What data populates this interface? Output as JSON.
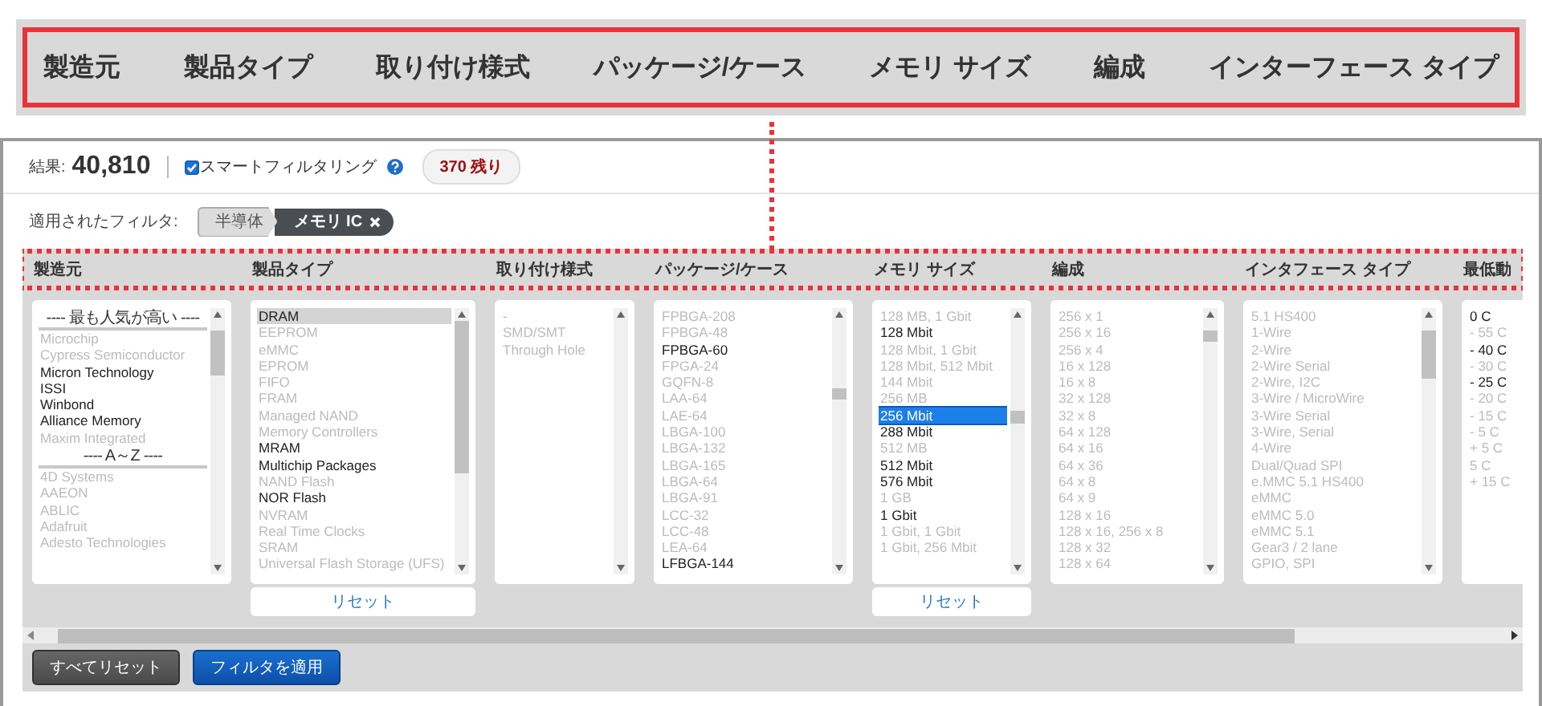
{
  "banner": {
    "headings": [
      "製造元",
      "製品タイプ",
      "取り付け様式",
      "パッケージ/ケース",
      "メモリ サイズ",
      "編成",
      "インターフェース タイプ"
    ]
  },
  "summary": {
    "results_label": "結果:",
    "results_count": "40,810",
    "smart_filtering": {
      "label": "スマートフィルタリング",
      "checked": true
    },
    "remaining": "370 残り"
  },
  "applied_filters": {
    "label": "適用されたフィルタ:",
    "chips": [
      {
        "label": "半導体",
        "kind": "category"
      },
      {
        "label": "メモリ IC",
        "kind": "removable"
      }
    ]
  },
  "columns": [
    {
      "heading": "製造元",
      "options": [
        {
          "kind": "heading",
          "label": "---- 最も人気が高い ----"
        },
        {
          "kind": "option",
          "label": "Microchip",
          "disabled": true,
          "selected": false
        },
        {
          "kind": "option",
          "label": "Cypress Semiconductor",
          "disabled": true,
          "selected": false
        },
        {
          "kind": "option",
          "label": "Micron Technology",
          "disabled": false,
          "selected": false
        },
        {
          "kind": "option",
          "label": "ISSI",
          "disabled": false,
          "selected": false
        },
        {
          "kind": "option",
          "label": "Winbond",
          "disabled": false,
          "selected": false
        },
        {
          "kind": "option",
          "label": "Alliance Memory",
          "disabled": false,
          "selected": false
        },
        {
          "kind": "option",
          "label": "Maxim Integrated",
          "disabled": true,
          "selected": false
        },
        {
          "kind": "heading",
          "label": "---- A～Z ----"
        },
        {
          "kind": "option",
          "label": "4D Systems",
          "disabled": true,
          "selected": false
        },
        {
          "kind": "option",
          "label": "AAEON",
          "disabled": true,
          "selected": false
        },
        {
          "kind": "option",
          "label": "ABLIC",
          "disabled": true,
          "selected": false
        },
        {
          "kind": "option",
          "label": "Adafruit",
          "disabled": true,
          "selected": false
        },
        {
          "kind": "option",
          "label": "Adesto Technologies",
          "disabled": true,
          "selected": false
        }
      ]
    },
    {
      "heading": "製品タイプ",
      "reset": "リセット",
      "options": [
        {
          "kind": "option",
          "label": "DRAM",
          "disabled": false,
          "selected": true,
          "focused": false
        },
        {
          "kind": "option",
          "label": "EEPROM",
          "disabled": true,
          "selected": false
        },
        {
          "kind": "option",
          "label": "eMMC",
          "disabled": true,
          "selected": false
        },
        {
          "kind": "option",
          "label": "EPROM",
          "disabled": true,
          "selected": false
        },
        {
          "kind": "option",
          "label": "FIFO",
          "disabled": true,
          "selected": false
        },
        {
          "kind": "option",
          "label": "FRAM",
          "disabled": true,
          "selected": false
        },
        {
          "kind": "option",
          "label": "Managed NAND",
          "disabled": true,
          "selected": false
        },
        {
          "kind": "option",
          "label": "Memory Controllers",
          "disabled": true,
          "selected": false
        },
        {
          "kind": "option",
          "label": "MRAM",
          "disabled": false,
          "selected": false
        },
        {
          "kind": "option",
          "label": "Multichip Packages",
          "disabled": false,
          "selected": false
        },
        {
          "kind": "option",
          "label": "NAND Flash",
          "disabled": true,
          "selected": false
        },
        {
          "kind": "option",
          "label": "NOR Flash",
          "disabled": false,
          "selected": false
        },
        {
          "kind": "option",
          "label": "NVRAM",
          "disabled": true,
          "selected": false
        },
        {
          "kind": "option",
          "label": "Real Time Clocks",
          "disabled": true,
          "selected": false
        },
        {
          "kind": "option",
          "label": "SRAM",
          "disabled": true,
          "selected": false
        },
        {
          "kind": "option",
          "label": "Universal Flash Storage (UFS)",
          "disabled": true,
          "selected": false
        }
      ]
    },
    {
      "heading": "取り付け様式",
      "options": [
        {
          "kind": "option",
          "label": "-",
          "disabled": true,
          "selected": false
        },
        {
          "kind": "option",
          "label": "SMD/SMT",
          "disabled": true,
          "selected": false
        },
        {
          "kind": "option",
          "label": "Through Hole",
          "disabled": true,
          "selected": false
        }
      ]
    },
    {
      "heading": "パッケージ/ケース",
      "options": [
        {
          "kind": "option",
          "label": "FPBGA-208",
          "disabled": true,
          "selected": false
        },
        {
          "kind": "option",
          "label": "FPBGA-48",
          "disabled": true,
          "selected": false
        },
        {
          "kind": "option",
          "label": "FPBGA-60",
          "disabled": false,
          "selected": false
        },
        {
          "kind": "option",
          "label": "FPGA-24",
          "disabled": true,
          "selected": false
        },
        {
          "kind": "option",
          "label": "GQFN-8",
          "disabled": true,
          "selected": false
        },
        {
          "kind": "option",
          "label": "LAA-64",
          "disabled": true,
          "selected": false
        },
        {
          "kind": "option",
          "label": "LAE-64",
          "disabled": true,
          "selected": false
        },
        {
          "kind": "option",
          "label": "LBGA-100",
          "disabled": true,
          "selected": false
        },
        {
          "kind": "option",
          "label": "LBGA-132",
          "disabled": true,
          "selected": false
        },
        {
          "kind": "option",
          "label": "LBGA-165",
          "disabled": true,
          "selected": false
        },
        {
          "kind": "option",
          "label": "LBGA-64",
          "disabled": true,
          "selected": false
        },
        {
          "kind": "option",
          "label": "LBGA-91",
          "disabled": true,
          "selected": false
        },
        {
          "kind": "option",
          "label": "LCC-32",
          "disabled": true,
          "selected": false
        },
        {
          "kind": "option",
          "label": "LCC-48",
          "disabled": true,
          "selected": false
        },
        {
          "kind": "option",
          "label": "LEA-64",
          "disabled": true,
          "selected": false
        },
        {
          "kind": "option",
          "label": "LFBGA-144",
          "disabled": false,
          "selected": false
        }
      ]
    },
    {
      "heading": "メモリ サイズ",
      "reset": "リセット",
      "options": [
        {
          "kind": "option",
          "label": "128 MB, 1 Gbit",
          "disabled": true,
          "selected": false
        },
        {
          "kind": "option",
          "label": "128 Mbit",
          "disabled": false,
          "selected": false
        },
        {
          "kind": "option",
          "label": "128 Mbit, 1 Gbit",
          "disabled": true,
          "selected": false
        },
        {
          "kind": "option",
          "label": "128 Mbit, 512 Mbit",
          "disabled": true,
          "selected": false
        },
        {
          "kind": "option",
          "label": "144 Mbit",
          "disabled": true,
          "selected": false
        },
        {
          "kind": "option",
          "label": "256 MB",
          "disabled": true,
          "selected": false
        },
        {
          "kind": "option",
          "label": "256 Mbit",
          "disabled": false,
          "selected": true,
          "focused": true
        },
        {
          "kind": "option",
          "label": "288 Mbit",
          "disabled": false,
          "selected": false
        },
        {
          "kind": "option",
          "label": "512 MB",
          "disabled": true,
          "selected": false
        },
        {
          "kind": "option",
          "label": "512 Mbit",
          "disabled": false,
          "selected": false
        },
        {
          "kind": "option",
          "label": "576 Mbit",
          "disabled": false,
          "selected": false
        },
        {
          "kind": "option",
          "label": "1 GB",
          "disabled": true,
          "selected": false
        },
        {
          "kind": "option",
          "label": "1 Gbit",
          "disabled": false,
          "selected": false
        },
        {
          "kind": "option",
          "label": "1 Gbit, 1 Gbit",
          "disabled": true,
          "selected": false
        },
        {
          "kind": "option",
          "label": "1 Gbit, 256 Mbit",
          "disabled": true,
          "selected": false
        }
      ]
    },
    {
      "heading": "編成",
      "options": [
        {
          "kind": "option",
          "label": "256 x 1",
          "disabled": true,
          "selected": false
        },
        {
          "kind": "option",
          "label": "256 x 16",
          "disabled": true,
          "selected": false
        },
        {
          "kind": "option",
          "label": "256 x 4",
          "disabled": true,
          "selected": false
        },
        {
          "kind": "option",
          "label": "16 x 128",
          "disabled": true,
          "selected": false
        },
        {
          "kind": "option",
          "label": "16 x 8",
          "disabled": true,
          "selected": false
        },
        {
          "kind": "option",
          "label": "32 x 128",
          "disabled": true,
          "selected": false
        },
        {
          "kind": "option",
          "label": "32 x 8",
          "disabled": true,
          "selected": false
        },
        {
          "kind": "option",
          "label": "64 x 128",
          "disabled": true,
          "selected": false
        },
        {
          "kind": "option",
          "label": "64 x 16",
          "disabled": true,
          "selected": false
        },
        {
          "kind": "option",
          "label": "64 x 36",
          "disabled": true,
          "selected": false
        },
        {
          "kind": "option",
          "label": "64 x 8",
          "disabled": true,
          "selected": false
        },
        {
          "kind": "option",
          "label": "64 x 9",
          "disabled": true,
          "selected": false
        },
        {
          "kind": "option",
          "label": "128 x 16",
          "disabled": true,
          "selected": false
        },
        {
          "kind": "option",
          "label": "128 x 16, 256 x 8",
          "disabled": true,
          "selected": false
        },
        {
          "kind": "option",
          "label": "128 x 32",
          "disabled": true,
          "selected": false
        },
        {
          "kind": "option",
          "label": "128 x 64",
          "disabled": true,
          "selected": false
        }
      ]
    },
    {
      "heading": "インタフェース タイプ",
      "options": [
        {
          "kind": "option",
          "label": "5.1 HS400",
          "disabled": true,
          "selected": false
        },
        {
          "kind": "option",
          "label": "1-Wire",
          "disabled": true,
          "selected": false
        },
        {
          "kind": "option",
          "label": "2-Wire",
          "disabled": true,
          "selected": false
        },
        {
          "kind": "option",
          "label": "2-Wire Serial",
          "disabled": true,
          "selected": false
        },
        {
          "kind": "option",
          "label": "2-Wire, I2C",
          "disabled": true,
          "selected": false
        },
        {
          "kind": "option",
          "label": "3-Wire / MicroWire",
          "disabled": true,
          "selected": false
        },
        {
          "kind": "option",
          "label": "3-Wire Serial",
          "disabled": true,
          "selected": false
        },
        {
          "kind": "option",
          "label": "3-Wire, Serial",
          "disabled": true,
          "selected": false
        },
        {
          "kind": "option",
          "label": "4-Wire",
          "disabled": true,
          "selected": false
        },
        {
          "kind": "option",
          "label": "Dual/Quad SPI",
          "disabled": true,
          "selected": false
        },
        {
          "kind": "option",
          "label": "e.MMC 5.1 HS400",
          "disabled": true,
          "selected": false
        },
        {
          "kind": "option",
          "label": "eMMC",
          "disabled": true,
          "selected": false
        },
        {
          "kind": "option",
          "label": "eMMC 5.0",
          "disabled": true,
          "selected": false
        },
        {
          "kind": "option",
          "label": "eMMC 5.1",
          "disabled": true,
          "selected": false
        },
        {
          "kind": "option",
          "label": "Gear3 / 2 lane",
          "disabled": true,
          "selected": false
        },
        {
          "kind": "option",
          "label": "GPIO, SPI",
          "disabled": true,
          "selected": false
        }
      ]
    },
    {
      "heading": "最低動",
      "options": [
        {
          "kind": "option",
          "label": "0 C",
          "disabled": false,
          "selected": false
        },
        {
          "kind": "option",
          "label": "- 55 C",
          "disabled": true,
          "selected": false
        },
        {
          "kind": "option",
          "label": "- 40 C",
          "disabled": false,
          "selected": false
        },
        {
          "kind": "option",
          "label": "- 30 C",
          "disabled": true,
          "selected": false
        },
        {
          "kind": "option",
          "label": "- 25 C",
          "disabled": false,
          "selected": false
        },
        {
          "kind": "option",
          "label": "- 20 C",
          "disabled": true,
          "selected": false
        },
        {
          "kind": "option",
          "label": "- 15 C",
          "disabled": true,
          "selected": false
        },
        {
          "kind": "option",
          "label": "- 5 C",
          "disabled": true,
          "selected": false
        },
        {
          "kind": "option",
          "label": "+ 5 C",
          "disabled": true,
          "selected": false
        },
        {
          "kind": "option",
          "label": "5 C",
          "disabled": true,
          "selected": false
        },
        {
          "kind": "option",
          "label": "+ 15 C",
          "disabled": true,
          "selected": false
        }
      ]
    }
  ],
  "actions": [
    {
      "label": "すべてリセット",
      "kind": "secondary"
    },
    {
      "label": "フィルタを適用",
      "kind": "primary"
    }
  ]
}
